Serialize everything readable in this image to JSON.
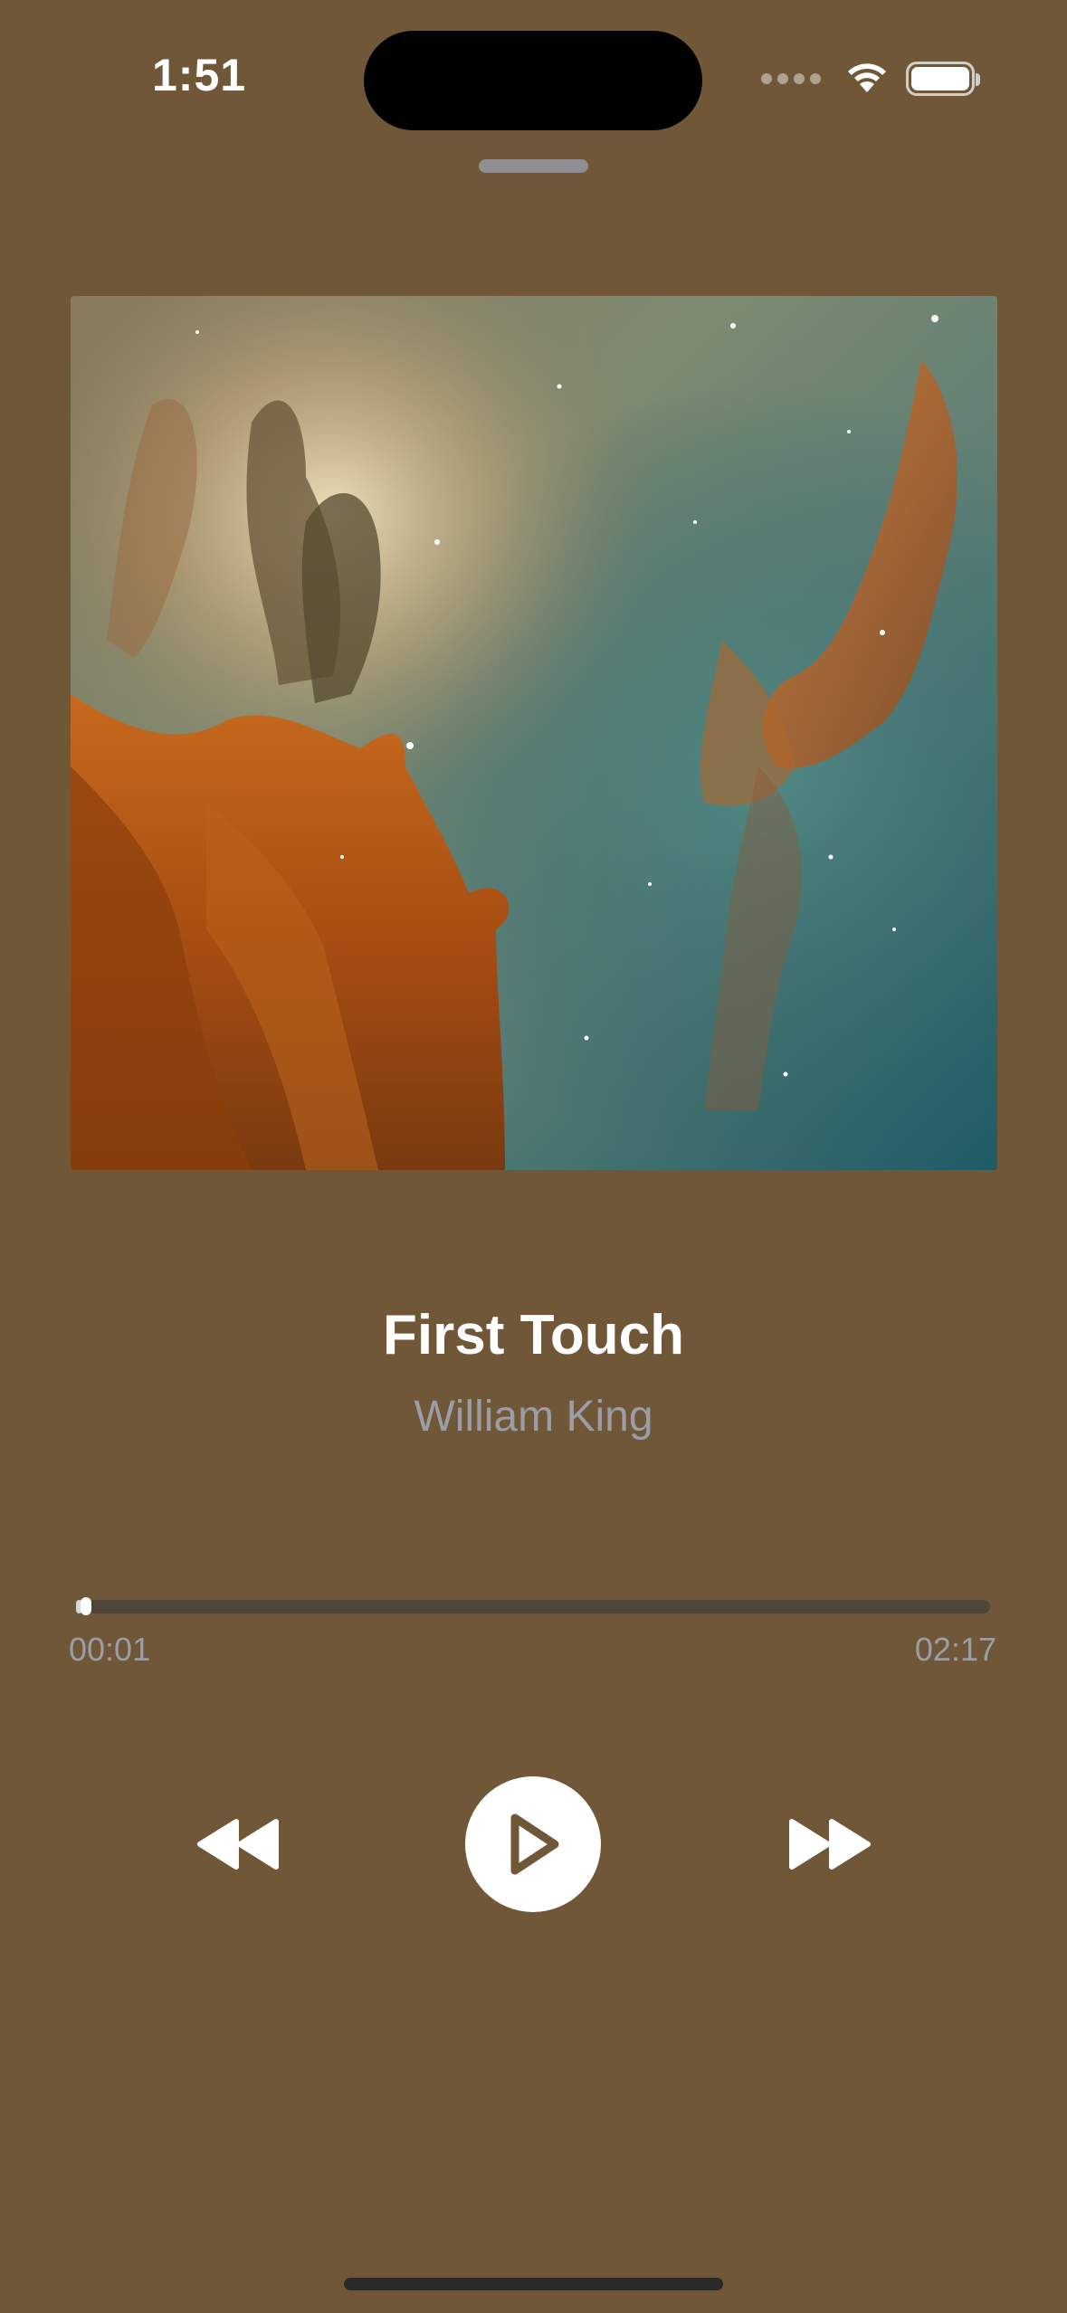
{
  "status_bar": {
    "time": "1:51",
    "icons": [
      "cellular-signal-icon",
      "wifi-icon",
      "battery-icon"
    ]
  },
  "now_playing": {
    "artwork": "nebula-artwork",
    "title": "First Touch",
    "artist": "William King"
  },
  "playback": {
    "elapsed": "00:01",
    "duration": "02:17",
    "progress_fraction": 0.007
  },
  "controls": {
    "rewind_icon": "rewind-icon",
    "play_icon": "play-icon",
    "forward_icon": "fast-forward-icon"
  },
  "colors": {
    "background": "#6f5737",
    "title": "#ffffff",
    "subtitle": "#9b9ea6",
    "track": "#4f4538"
  }
}
